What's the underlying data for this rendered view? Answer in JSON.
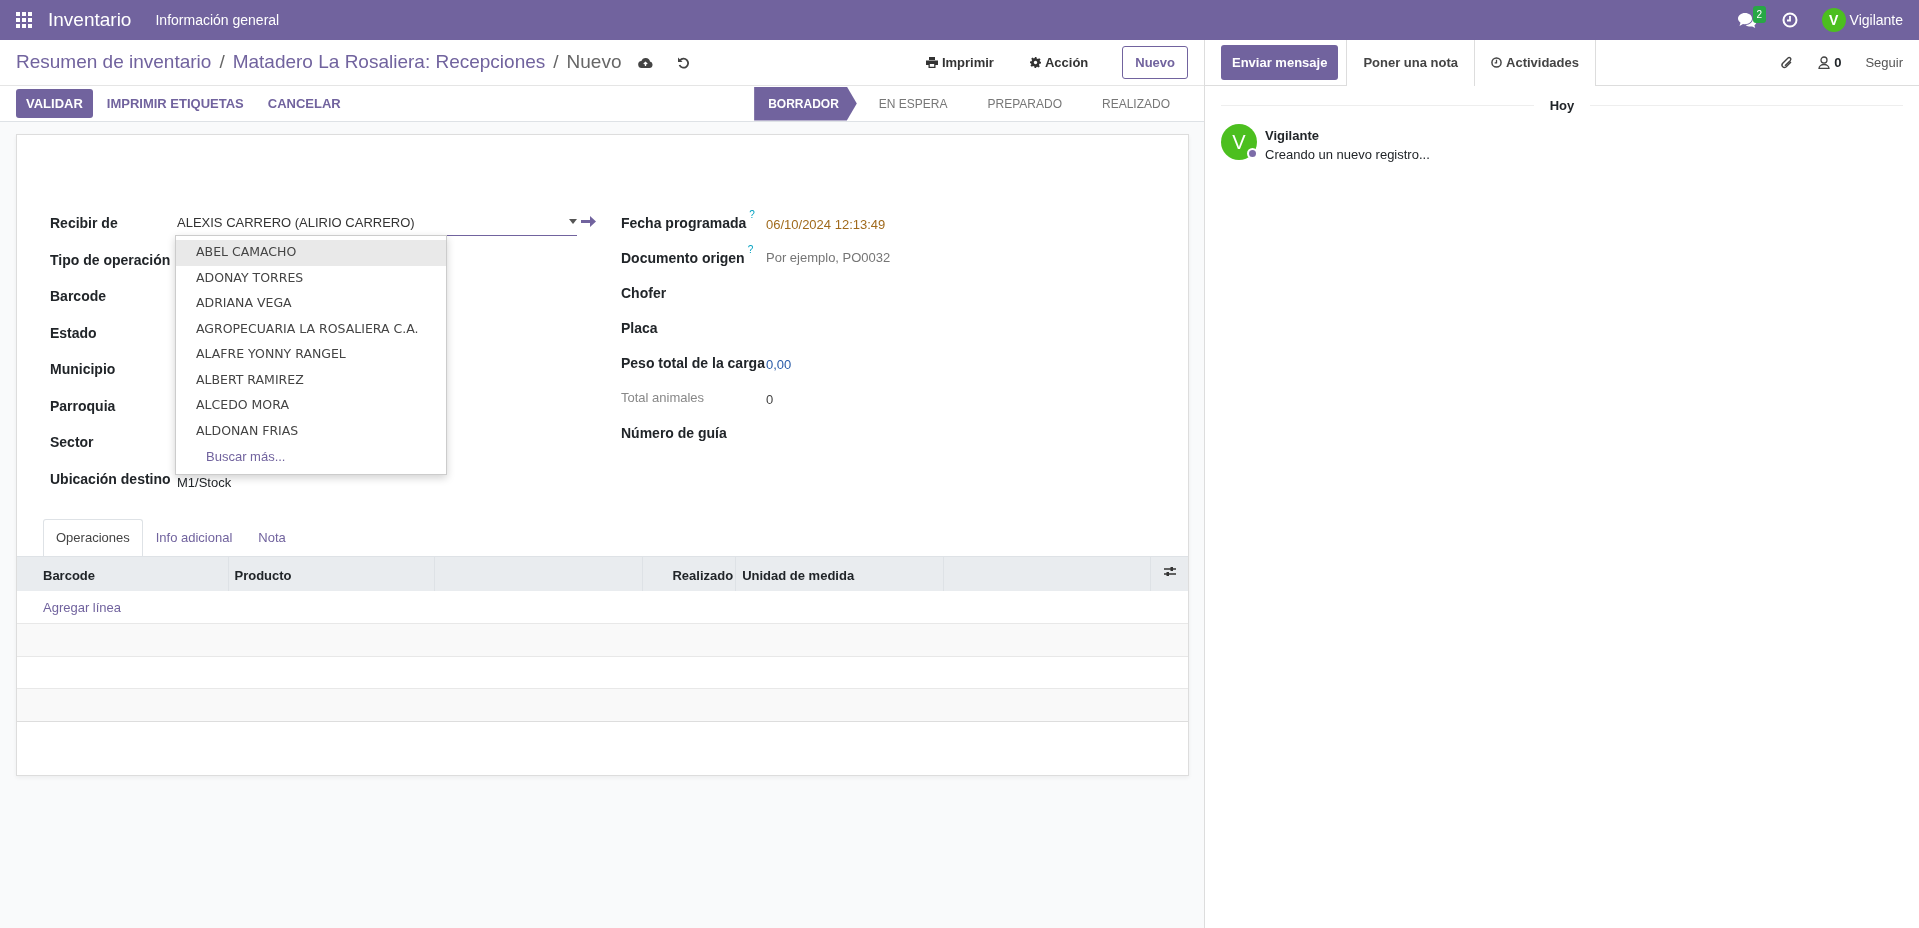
{
  "navbar": {
    "app": "Inventario",
    "menu": [
      "Información general"
    ],
    "messages_count": "2",
    "user_initial": "V",
    "user": "Vigilante"
  },
  "breadcrumbs": [
    "Resumen de inventario",
    "Matadero La Rosaliera: Recepciones",
    "Nuevo"
  ],
  "breadcrumb_separators": [
    "/",
    "/"
  ],
  "actions": [
    {
      "label": "Imprimir",
      "kind": "print"
    },
    {
      "label": "Acción",
      "kind": "gear"
    }
  ],
  "new_button": "Nuevo",
  "buttons": [
    {
      "label": "VALIDAR",
      "kind": "primary"
    },
    {
      "label": "IMPRIMIR ETIQUETAS",
      "kind": "link"
    },
    {
      "label": "CANCELAR",
      "kind": "link"
    }
  ],
  "stages": [
    {
      "label": "BORRADOR",
      "selected": true
    },
    {
      "label": "EN ESPERA",
      "selected": false
    },
    {
      "label": "PREPARADO",
      "selected": false
    },
    {
      "label": "REALIZADO",
      "selected": false
    }
  ],
  "form": {
    "left": [
      {
        "label": "Recibir de",
        "value": "ALEXIS CARRERO (ALIRIO CARRERO)",
        "kind": "many2one"
      },
      {
        "label": "Tipo de operación"
      },
      {
        "label": "Barcode"
      },
      {
        "label": "Estado"
      },
      {
        "label": "Municipio"
      },
      {
        "label": "Parroquia"
      },
      {
        "label": "Sector"
      },
      {
        "label": "Ubicación destino",
        "value": "M1/Stock"
      }
    ],
    "right": [
      {
        "label": "Fecha programada",
        "help": "?",
        "value": "06/10/2024 12:13:49",
        "kind": "date"
      },
      {
        "label": "Documento origen",
        "help": "?",
        "placeholder": "Por ejemplo, PO0032"
      },
      {
        "label": "Chofer"
      },
      {
        "label": "Placa"
      },
      {
        "label": "Peso total de la carga",
        "value": "0,00",
        "kind": "number"
      },
      {
        "label": "Total animales",
        "value": "0",
        "kind": "readonly"
      },
      {
        "label": "Número de guía"
      }
    ]
  },
  "dropdown": {
    "options": [
      {
        "label": "ABEL CAMACHO",
        "selected": true
      },
      {
        "label": "ADONAY TORRES",
        "selected": false
      },
      {
        "label": "ADRIANA VEGA",
        "selected": false
      },
      {
        "label": "AGROPECUARIA LA ROSALIERA C.A.",
        "selected": false
      },
      {
        "label": "ALAFRE YONNY RANGEL",
        "selected": false
      },
      {
        "label": "ALBERT RAMIREZ",
        "selected": false
      },
      {
        "label": "ALCEDO MORA",
        "selected": false
      },
      {
        "label": "ALDONAN FRIAS",
        "selected": false
      }
    ],
    "more": "Buscar más..."
  },
  "tabs": [
    {
      "label": "Operaciones",
      "selected": true
    },
    {
      "label": "Info adicional",
      "selected": false
    },
    {
      "label": "Nota",
      "selected": false
    }
  ],
  "table": {
    "columns": [
      {
        "label": "Barcode",
        "kind": "text"
      },
      {
        "label": "Producto",
        "kind": "text"
      },
      {
        "kind": "blank"
      },
      {
        "label": "Realizado",
        "kind": "number"
      },
      {
        "label": "Unidad de medida",
        "kind": "text"
      },
      {
        "kind": "blank"
      },
      {
        "kind": "settings"
      }
    ],
    "add_line": "Agregar línea"
  },
  "chatter": {
    "tabs": [
      {
        "label": "Enviar mensaje",
        "kind": "primary"
      },
      {
        "label": "Poner una nota",
        "kind": "tab"
      },
      {
        "label": "Actividades",
        "kind": "activity"
      }
    ],
    "followers": "0",
    "follow": "Seguir",
    "date": "Hoy",
    "messages": [
      {
        "initial": "V",
        "author": "Vigilante",
        "body": "Creando un nuevo registro..."
      }
    ]
  }
}
